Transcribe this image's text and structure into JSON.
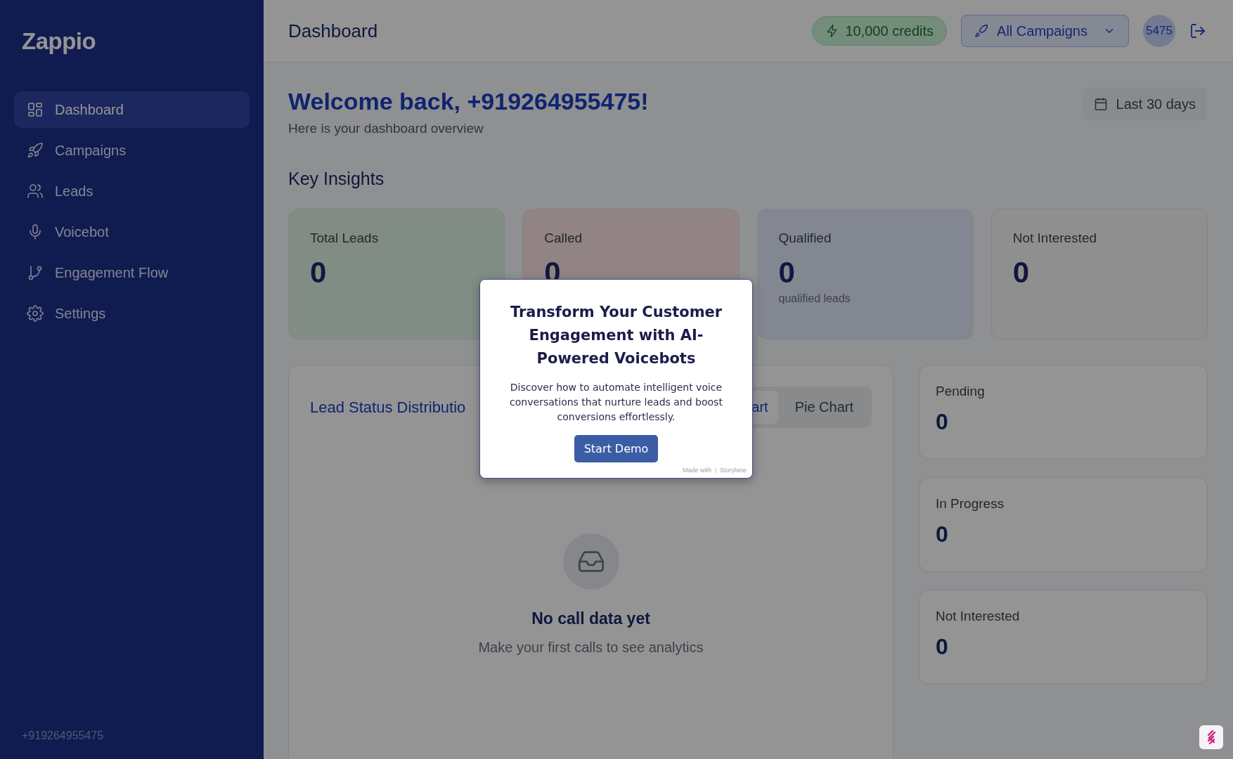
{
  "sidebar": {
    "logo": "Zappio",
    "items": [
      {
        "label": "Dashboard",
        "selected": true
      },
      {
        "label": "Campaigns",
        "selected": false
      },
      {
        "label": "Leads",
        "selected": false
      },
      {
        "label": "Voicebot",
        "selected": false
      },
      {
        "label": "Engagement Flow",
        "selected": false
      },
      {
        "label": "Settings",
        "selected": false
      }
    ],
    "footer": "+919264955475"
  },
  "header": {
    "title": "Dashboard",
    "credits": "10,000 credits",
    "campaign_select": "All Campaigns",
    "avatar": "5475"
  },
  "welcome": {
    "title": "Welcome back, +919264955475!",
    "subtitle": "Here is your dashboard overview",
    "date_range": "Last 30 days"
  },
  "key_insights": {
    "title": "Key Insights",
    "cards": [
      {
        "label": "Total Leads",
        "value": "0",
        "color": "#818d84"
      },
      {
        "label": "Called",
        "value": "0",
        "color": "#928384"
      },
      {
        "label": "Qualified",
        "value": "0",
        "note": "qualified leads",
        "color": "#838792"
      },
      {
        "label": "Not Interested",
        "value": "0",
        "color": "#8f8f90"
      }
    ]
  },
  "chart_panel": {
    "title": "Lead Status Distributio",
    "tabs": [
      {
        "label": "art",
        "selected": true
      },
      {
        "label": "Pie Chart",
        "selected": false
      }
    ],
    "empty_title": "No call data yet",
    "empty_text": "Make your first calls to see analytics"
  },
  "status_cards": [
    {
      "label": "Pending",
      "value": "0"
    },
    {
      "label": "In Progress",
      "value": "0"
    },
    {
      "label": "Not Interested",
      "value": "0"
    }
  ],
  "popup": {
    "title": "Transform Your Customer Engagement with AI-Powered Voicebots",
    "body": "Discover how to automate intelligent voice conversations that nurture leads and boost conversions effortlessly.",
    "button": "Start Demo",
    "footer_prefix": "Made with",
    "footer_brand": "Storylane"
  }
}
